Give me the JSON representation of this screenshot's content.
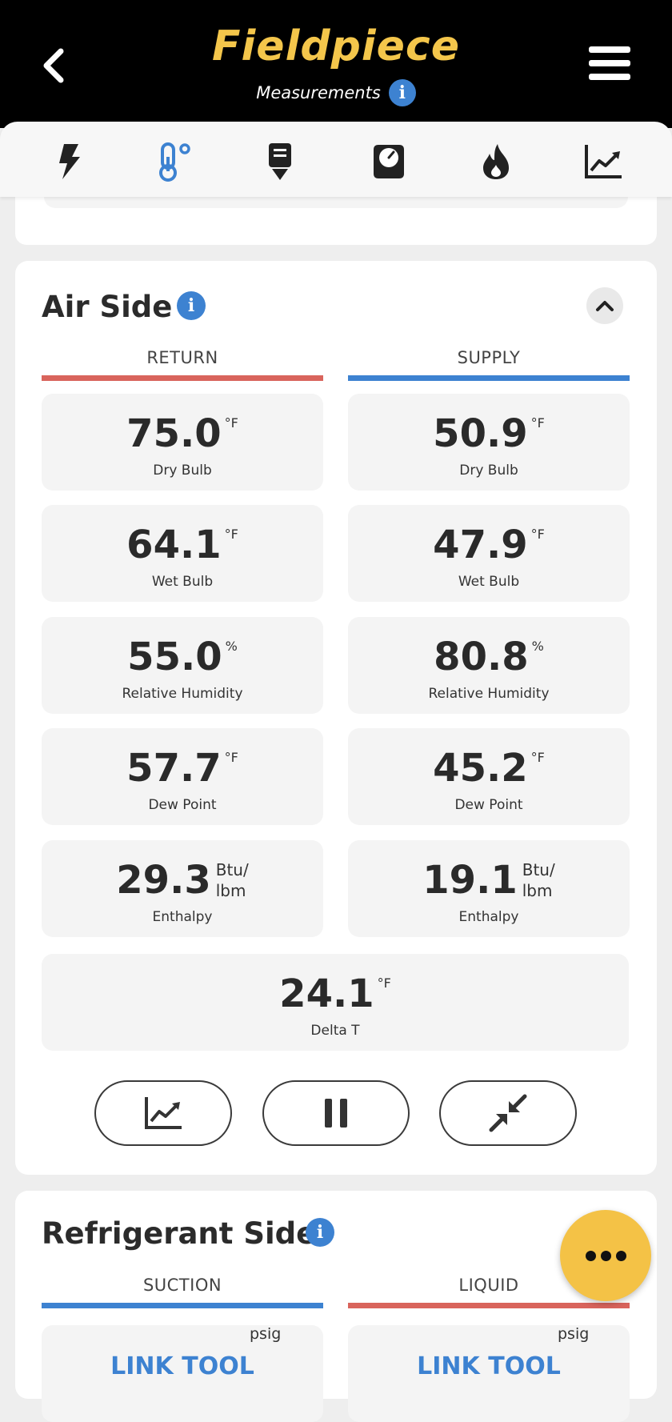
{
  "header": {
    "logo_text": "Fieldpiece",
    "subtitle": "Measurements",
    "info_glyph": "i",
    "logo_color": "#f4c64b",
    "background": "#000000"
  },
  "tabs": [
    {
      "icon": "bolt-icon"
    },
    {
      "icon": "thermometer-icon",
      "active": true
    },
    {
      "icon": "probe-icon"
    },
    {
      "icon": "gauge-icon"
    },
    {
      "icon": "flame-icon"
    },
    {
      "icon": "trend-chart-icon"
    }
  ],
  "air_side": {
    "title": "Air Side",
    "info_glyph": "i",
    "return_label": "RETURN",
    "supply_label": "SUPPLY",
    "return_color": "#d9645c",
    "supply_color": "#3d82d1",
    "return": [
      {
        "value": "75.0",
        "unit": "°F",
        "label": "Dry Bulb"
      },
      {
        "value": "64.1",
        "unit": "°F",
        "label": "Wet Bulb"
      },
      {
        "value": "55.0",
        "unit": "%",
        "label": "Relative Humidity"
      },
      {
        "value": "57.7",
        "unit": "°F",
        "label": "Dew Point"
      },
      {
        "value": "29.3",
        "unit_line1": "Btu/",
        "unit_line2": "lbm",
        "label": "Enthalpy"
      }
    ],
    "supply": [
      {
        "value": "50.9",
        "unit": "°F",
        "label": "Dry Bulb"
      },
      {
        "value": "47.9",
        "unit": "°F",
        "label": "Wet Bulb"
      },
      {
        "value": "80.8",
        "unit": "%",
        "label": "Relative Humidity"
      },
      {
        "value": "45.2",
        "unit": "°F",
        "label": "Dew Point"
      },
      {
        "value": "19.1",
        "unit_line1": "Btu/",
        "unit_line2": "lbm",
        "label": "Enthalpy"
      }
    ],
    "delta_t": {
      "value": "24.1",
      "unit": "°F",
      "label": "Delta T"
    },
    "actions": [
      {
        "icon": "trend-chart-icon"
      },
      {
        "icon": "pause-icon"
      },
      {
        "icon": "collapse-arrows-icon"
      }
    ]
  },
  "refrigerant_side": {
    "title": "Refrigerant Side",
    "info_glyph": "i",
    "suction_label": "SUCTION",
    "liquid_label": "LIQUID",
    "suction_color": "#3d82d1",
    "liquid_color": "#d9645c",
    "suction_link": "LINK TOOL",
    "liquid_link": "LINK TOOL",
    "suction_unit": "psig",
    "liquid_unit": "psig"
  },
  "fab": {
    "icon": "more-dots-icon",
    "color": "#f4c246"
  }
}
